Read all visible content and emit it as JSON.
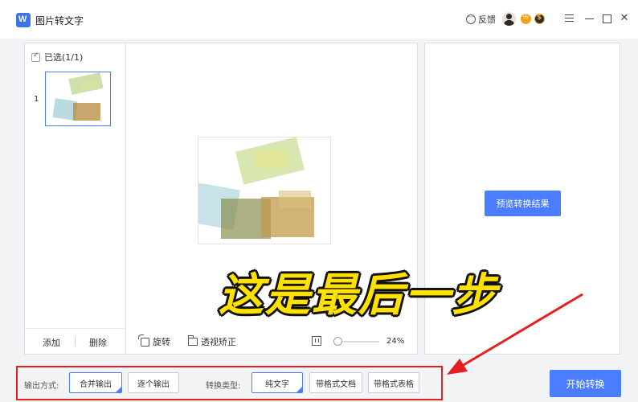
{
  "window": {
    "title": "图片转文字",
    "feedback_label": "反馈",
    "icons": [
      "app-logo-icon",
      "feedback-icon",
      "vip-crown-icon",
      "coin-icon",
      "menu-icon",
      "minimize-icon",
      "maximize-icon",
      "close-icon"
    ]
  },
  "thumbnails": {
    "select_all_label": "已选(1/1)",
    "items": [
      {
        "index": "1"
      }
    ],
    "add_label": "添加",
    "delete_label": "删除"
  },
  "preview": {
    "rotate_label": "旋转",
    "perspective_label": "透视矫正",
    "zoom_label": "24%",
    "zoom_fraction": 0.24
  },
  "result": {
    "preview_button_label": "预览转换结果"
  },
  "caption": "这是最后一步",
  "options": {
    "output_mode_label": "输出方式:",
    "output_modes": [
      "合并输出",
      "逐个输出"
    ],
    "output_selected": "合并输出",
    "convert_type_label": "转换类型:",
    "convert_types": [
      "纯文字",
      "带格式文档",
      "带格式表格"
    ],
    "convert_selected": "纯文字",
    "start_label": "开始转换"
  },
  "colors": {
    "accent": "#4a7dff",
    "highlight": "#e52020",
    "caption": "#ffe100"
  }
}
